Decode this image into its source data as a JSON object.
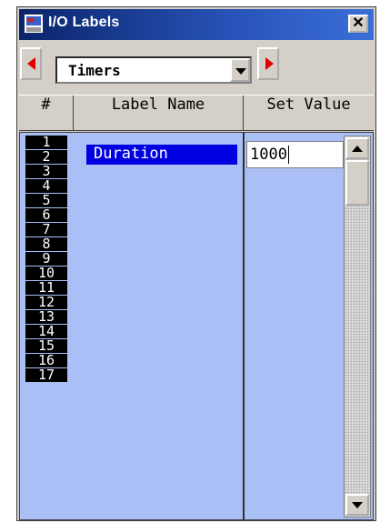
{
  "window": {
    "title": "I/O Labels",
    "close_label": "✕"
  },
  "selector": {
    "value": "Timers"
  },
  "table": {
    "headers": {
      "num": "#",
      "name": "Label Name",
      "value": "Set Value"
    },
    "row_numbers": [
      "1",
      "2",
      "3",
      "4",
      "5",
      "6",
      "7",
      "8",
      "9",
      "10",
      "11",
      "12",
      "13",
      "14",
      "15",
      "16",
      "17"
    ],
    "selected_row": {
      "name": "Duration",
      "value": "1000"
    }
  },
  "icons": {
    "app": "window-app-icon",
    "close": "close-icon",
    "prev": "arrow-left-icon",
    "next": "arrow-right-icon",
    "dropdown": "chevron-down-icon",
    "scroll_up": "scroll-up-icon",
    "scroll_down": "scroll-down-icon"
  },
  "colors": {
    "title_bar": "#0a246a",
    "table_bg": "#aabff6",
    "selection": "#0000e0",
    "arrow_red": "#e00000"
  }
}
